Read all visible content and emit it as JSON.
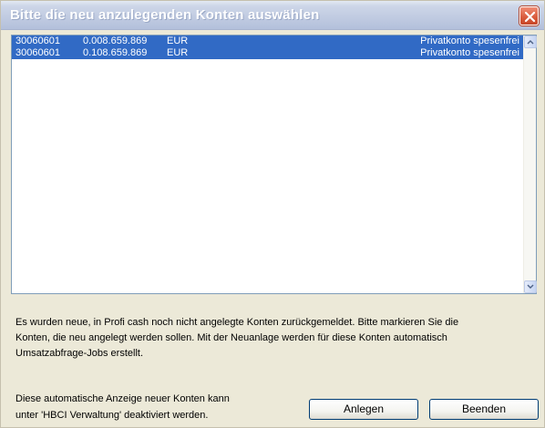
{
  "window": {
    "title": "Bitte die neu anzulegenden Konten auswählen"
  },
  "accounts": [
    {
      "blz": "30060601",
      "account": "0.008.659.869",
      "currency": "EUR",
      "description": "Privatkonto spesenfrei"
    },
    {
      "blz": "30060601",
      "account": "0.108.659.869",
      "currency": "EUR",
      "description": "Privatkonto spesenfrei"
    }
  ],
  "info": {
    "line1": "Es wurden neue, in Profi cash noch nicht angelegte Konten zurückgemeldet. Bitte markieren Sie die",
    "line2": "Konten, die neu angelegt werden sollen. Mit der Neuanlage werden für diese Konten automatisch",
    "line3": "Umsatzabfrage-Jobs erstellt."
  },
  "note": {
    "line1": "Diese automatische Anzeige neuer Konten kann",
    "line2": "unter 'HBCI Verwaltung' deaktiviert werden."
  },
  "buttons": {
    "create_label": "Anlegen",
    "close_label": "Beenden"
  },
  "colors": {
    "selection": "#316ac5",
    "dialog_bg": "#ece9d8",
    "close_button": "#d85a3b"
  },
  "icons": {
    "close": "close-icon",
    "scroll_up": "chevron-up-icon",
    "scroll_down": "chevron-down-icon"
  }
}
